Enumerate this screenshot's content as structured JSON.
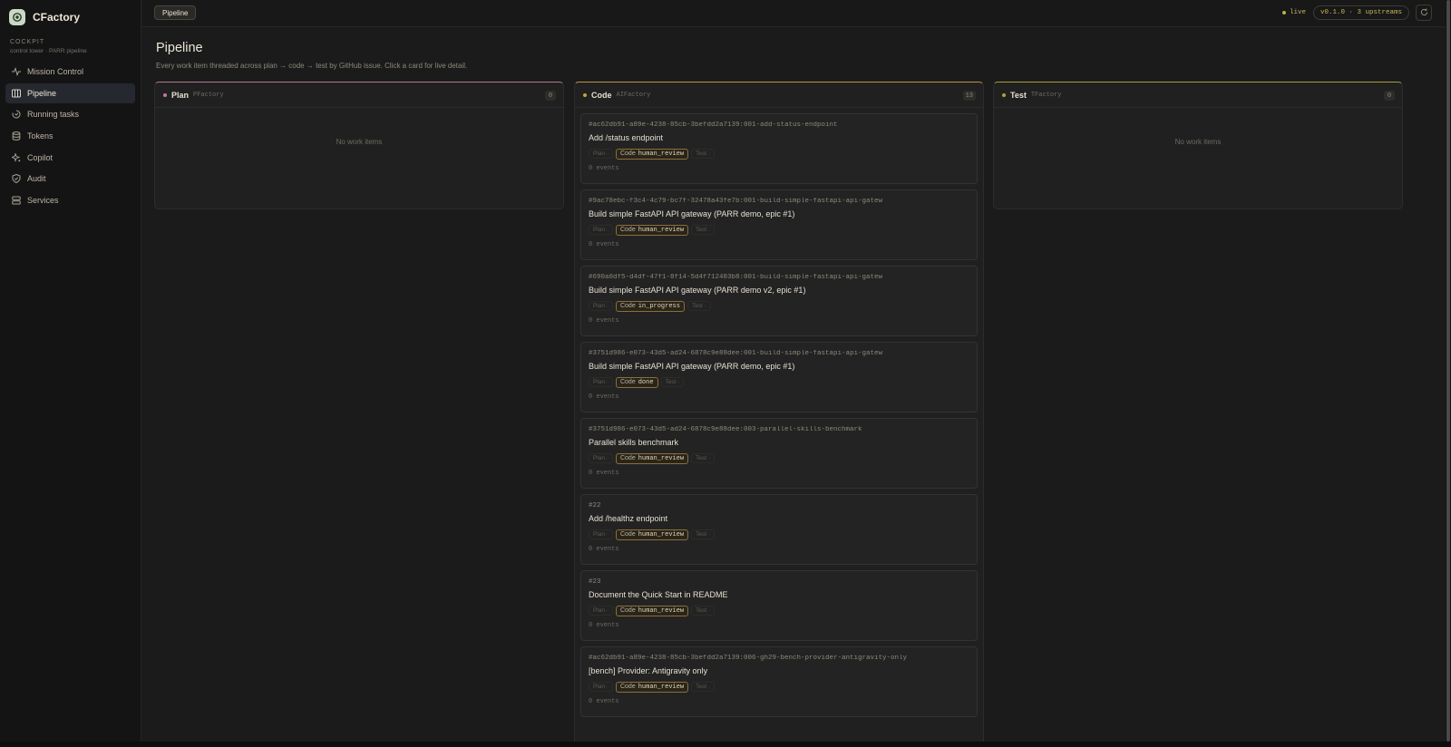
{
  "brand": {
    "name": "CFactory",
    "logo_icon": "gear-icon"
  },
  "cockpit": {
    "title": "COCKPIT",
    "subtitle": "control tower · PARR pipeline"
  },
  "sidebar": {
    "items": [
      {
        "label": "Mission Control",
        "icon": "activity-icon"
      },
      {
        "label": "Pipeline",
        "icon": "columns-icon",
        "active": true
      },
      {
        "label": "Running tasks",
        "icon": "spinner-icon"
      },
      {
        "label": "Tokens",
        "icon": "database-icon"
      },
      {
        "label": "Copilot",
        "icon": "sparkle-icon"
      },
      {
        "label": "Audit",
        "icon": "shield-icon"
      },
      {
        "label": "Services",
        "icon": "server-icon"
      }
    ]
  },
  "topbar": {
    "tab": "Pipeline",
    "live": "live",
    "version": "v0.1.0 · 3 upstreams",
    "refresh_icon": "refresh-icon"
  },
  "page": {
    "title": "Pipeline",
    "description": "Every work item threaded across plan → code → test by GitHub issue. Click a card for live detail."
  },
  "colors": {
    "plan": "#c27b94",
    "code": "#c9a035",
    "test": "#a8a63a"
  },
  "columns": {
    "plan": {
      "name": "Plan",
      "service": "PFactory",
      "count": "0",
      "empty": "No work items"
    },
    "code": {
      "name": "Code",
      "service": "AIFactory",
      "count": "13"
    },
    "test": {
      "name": "Test",
      "service": "TFactory",
      "count": "0",
      "empty": "No work items"
    }
  },
  "cards": [
    {
      "id": "#ac62db91-a89e-4238-85cb-3befdd2a7139:001-add-status-endpoint",
      "title": "Add /status endpoint",
      "plan": "Plan ·",
      "code": "Code",
      "status": "human_review",
      "test": "Test ·",
      "events": "0 events"
    },
    {
      "id": "#9ac78ebc-f3c4-4c79-bc7f-32478a43fe7b:001-build-simple-fastapi-api-gatew",
      "title": "Build simple FastAPI API gateway (PARR demo, epic #1)",
      "plan": "Plan ·",
      "code": "Code",
      "status": "human_review",
      "test": "Test ·",
      "events": "0 events"
    },
    {
      "id": "#690a0df5-d4df-47f1-8f14-5d4f712483b8:001-build-simple-fastapi-api-gatew",
      "title": "Build simple FastAPI API gateway (PARR demo v2, epic #1)",
      "plan": "Plan ·",
      "code": "Code",
      "status": "in_progress",
      "test": "Test ·",
      "events": "0 events"
    },
    {
      "id": "#3751d986-e073-43d5-ad24-6878c9e88dee:001-build-simple-fastapi-api-gatew",
      "title": "Build simple FastAPI API gateway (PARR demo, epic #1)",
      "plan": "Plan ·",
      "code": "Code",
      "status": "done",
      "test": "Test ·",
      "events": "0 events"
    },
    {
      "id": "#3751d986-e073-43d5-ad24-6878c9e88dee:003-parallel-skills-benchmark",
      "title": "Parallel skills benchmark",
      "plan": "Plan ·",
      "code": "Code",
      "status": "human_review",
      "test": "Test ·",
      "events": "0 events"
    },
    {
      "id": "#22",
      "title": "Add /healthz endpoint",
      "plan": "Plan ·",
      "code": "Code",
      "status": "human_review",
      "test": "Test ·",
      "events": "0 events"
    },
    {
      "id": "#23",
      "title": "Document the Quick Start in README",
      "plan": "Plan ·",
      "code": "Code",
      "status": "human_review",
      "test": "Test ·",
      "events": "0 events"
    },
    {
      "id": "#ac62db91-a89e-4238-85cb-3befdd2a7139:006-gh29-bench-provider-antigravity-only",
      "title": "[bench] Provider: Antigravity only",
      "plan": "Plan ·",
      "code": "Code",
      "status": "human_review",
      "test": "Test ·",
      "events": "0 events"
    }
  ]
}
